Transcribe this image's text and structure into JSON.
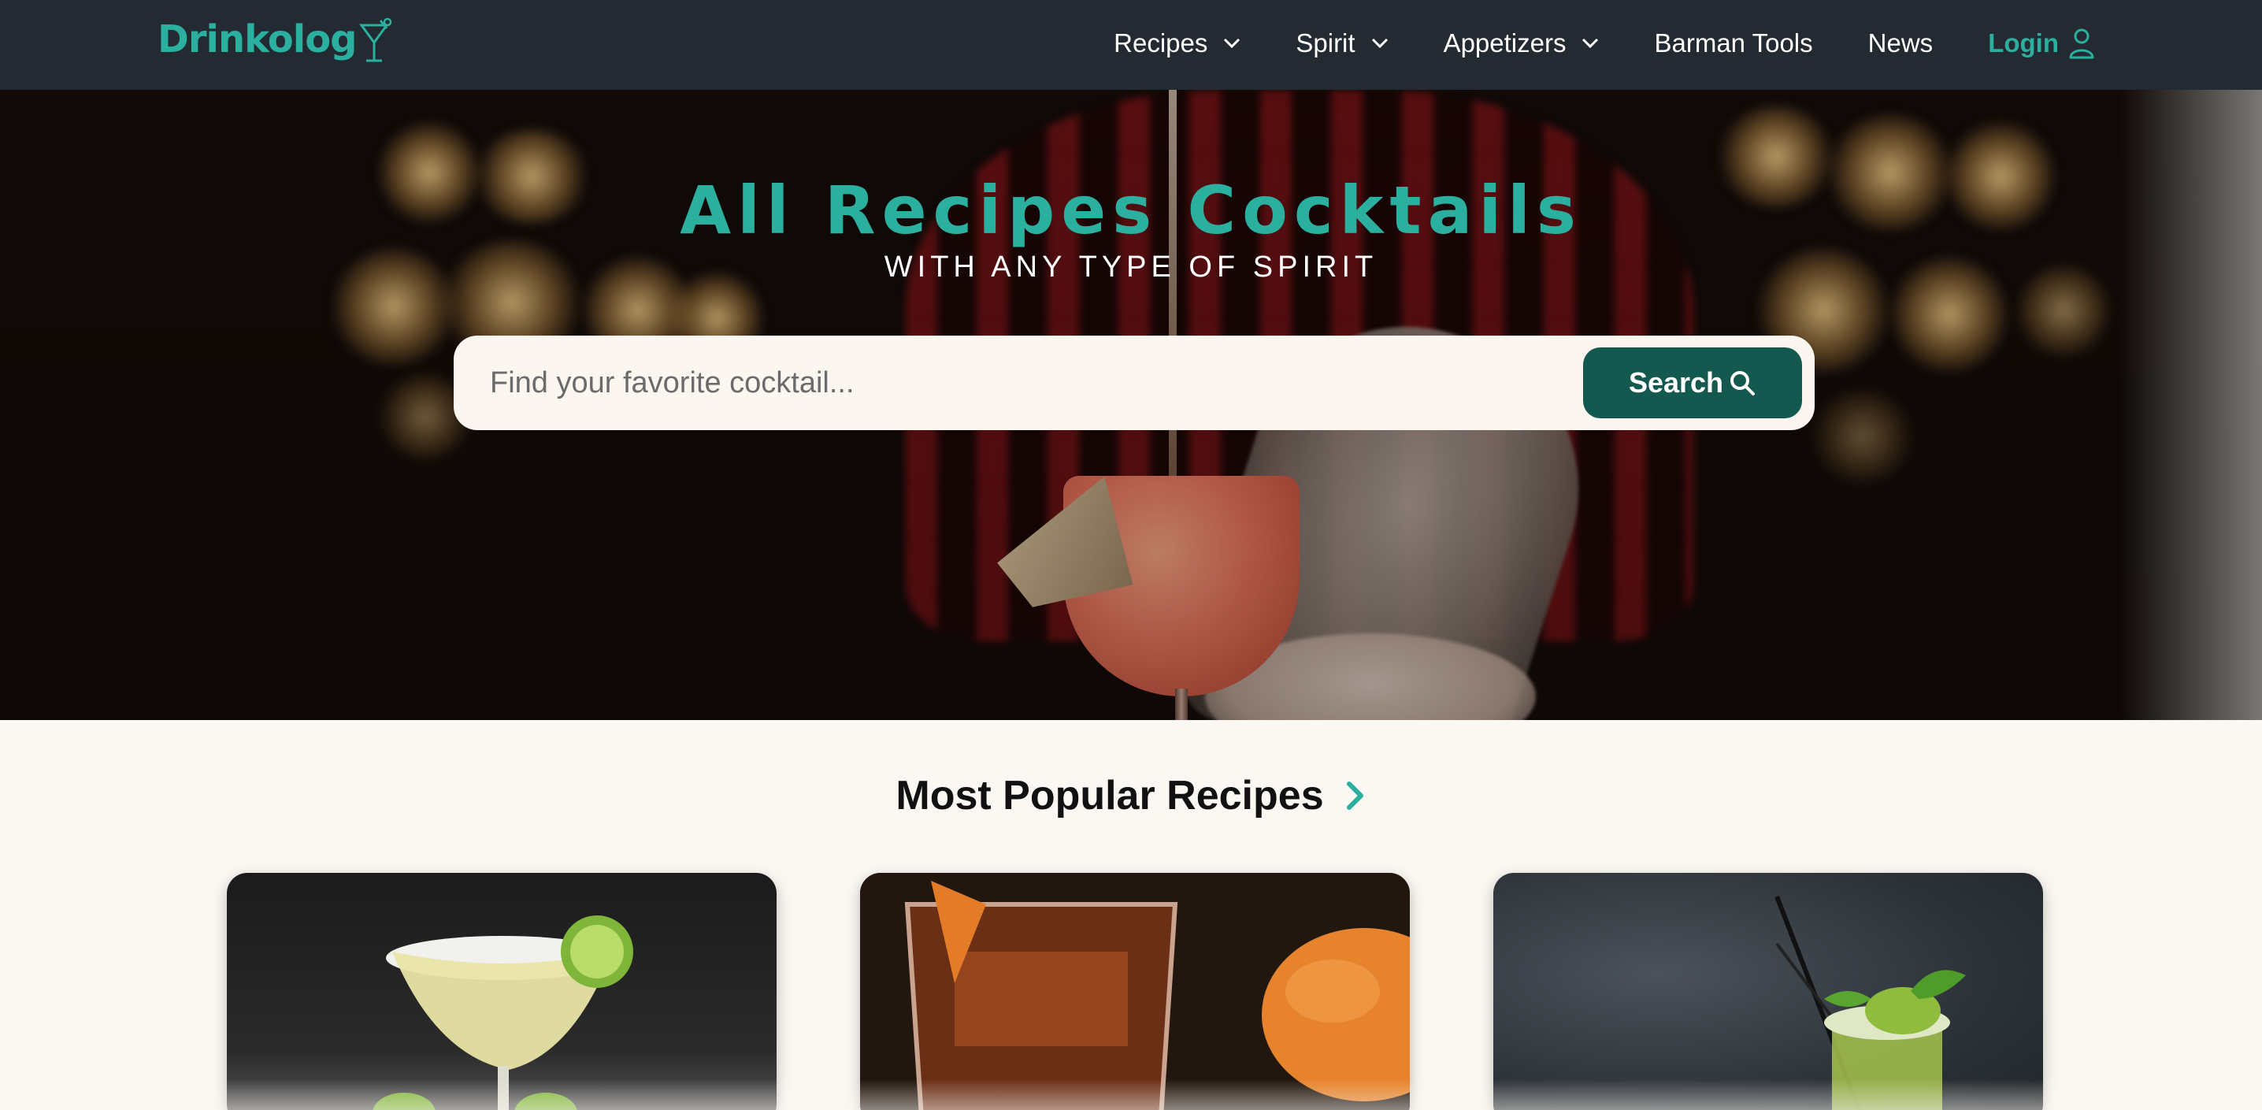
{
  "nav": {
    "logo": "Drinkolog",
    "items": [
      {
        "label": "Recipes"
      },
      {
        "label": "Spirit"
      },
      {
        "label": "Appetizers"
      },
      {
        "label": "Barman Tools"
      },
      {
        "label": "News"
      }
    ],
    "login": "Login"
  },
  "hero": {
    "title": "All Recipes Cocktails",
    "subtitle": "WITH ANY TYPE OF SPIRIT"
  },
  "search": {
    "placeholder": "Find your favorite cocktail...",
    "button_label": "Search"
  },
  "popular": {
    "title": "Most Popular Recipes"
  },
  "colors": {
    "accent": "#2bb0a0",
    "nav_bg": "#232a31",
    "button": "#14594f",
    "page_bg": "#fbf7f2"
  }
}
